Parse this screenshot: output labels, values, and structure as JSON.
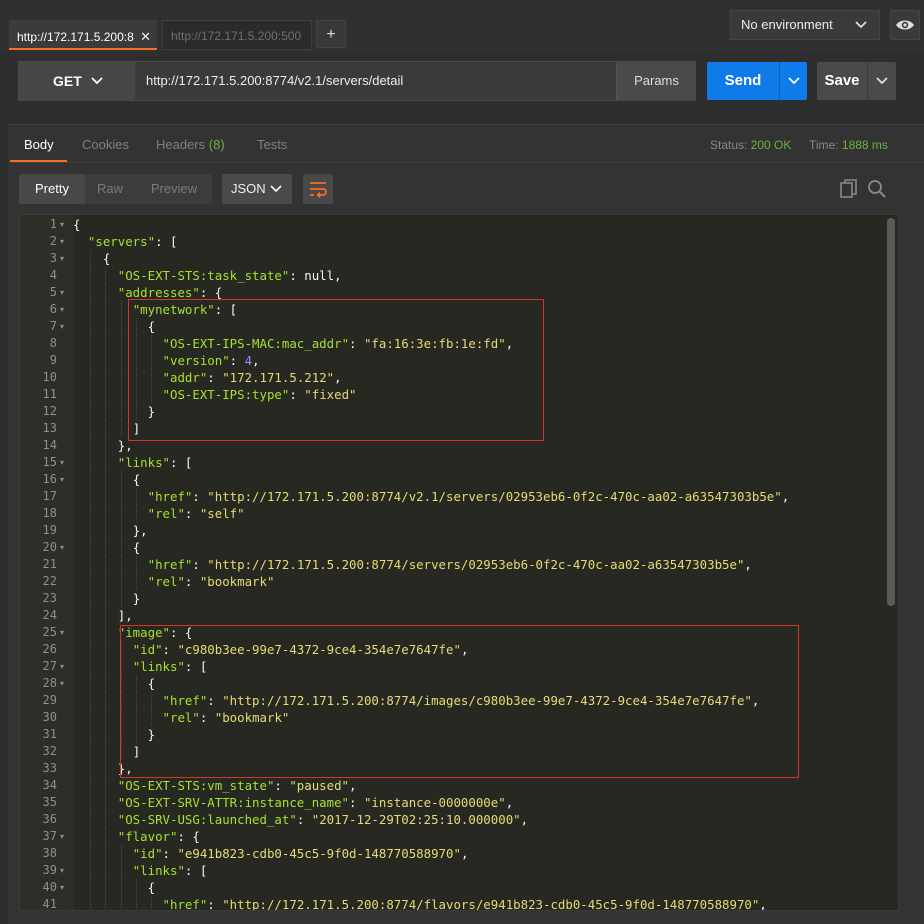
{
  "request_tabs": [
    {
      "label": "http://172.171.5.200:8",
      "active": true,
      "close": "✕"
    },
    {
      "label": "http://172.171.5.200:500",
      "active": false
    }
  ],
  "new_tab_label": "+",
  "environment": {
    "selected": "No environment"
  },
  "request": {
    "method": "GET",
    "url": "http://172.171.5.200:8774/v2.1/servers/detail",
    "params_label": "Params",
    "send_label": "Send",
    "save_label": "Save"
  },
  "response": {
    "tabs": [
      {
        "label": "Body",
        "active": true
      },
      {
        "label": "Cookies"
      },
      {
        "label": "Headers",
        "count": "(8)"
      },
      {
        "label": "Tests"
      }
    ],
    "status_label": "Status:",
    "status_value": "200 OK",
    "time_label": "Time:",
    "time_value": "1888 ms",
    "view_modes": [
      "Pretty",
      "Raw",
      "Preview"
    ],
    "active_view": "Pretty",
    "format": "JSON"
  },
  "colors": {
    "accent": "#f47023",
    "send": "#0f7be8",
    "status_ok": "#6cb43f",
    "highlight_box": "#d8332b"
  },
  "code_lines": [
    {
      "n": 1,
      "fold": true,
      "indent": 0,
      "t": [
        [
          "p",
          "{"
        ]
      ]
    },
    {
      "n": 2,
      "fold": true,
      "indent": 1,
      "t": [
        [
          "k",
          "\"servers\""
        ],
        [
          "p",
          ": ["
        ]
      ]
    },
    {
      "n": 3,
      "fold": true,
      "indent": 2,
      "t": [
        [
          "p",
          "{"
        ]
      ]
    },
    {
      "n": 4,
      "indent": 3,
      "t": [
        [
          "k",
          "\"OS-EXT-STS:task_state\""
        ],
        [
          "p",
          ": null,"
        ]
      ]
    },
    {
      "n": 5,
      "fold": true,
      "indent": 3,
      "t": [
        [
          "k",
          "\"addresses\""
        ],
        [
          "p",
          ": {"
        ]
      ]
    },
    {
      "n": 6,
      "fold": true,
      "indent": 4,
      "t": [
        [
          "k",
          "\"mynetwork\""
        ],
        [
          "p",
          ": ["
        ]
      ]
    },
    {
      "n": 7,
      "fold": true,
      "indent": 5,
      "t": [
        [
          "p",
          "{"
        ]
      ]
    },
    {
      "n": 8,
      "indent": 6,
      "t": [
        [
          "k",
          "\"OS-EXT-IPS-MAC:mac_addr\""
        ],
        [
          "p",
          ": "
        ],
        [
          "s",
          "\"fa:16:3e:fb:1e:fd\""
        ],
        [
          "p",
          ","
        ]
      ]
    },
    {
      "n": 9,
      "indent": 6,
      "t": [
        [
          "k",
          "\"version\""
        ],
        [
          "p",
          ": "
        ],
        [
          "n",
          "4"
        ],
        [
          "p",
          ","
        ]
      ]
    },
    {
      "n": 10,
      "indent": 6,
      "t": [
        [
          "k",
          "\"addr\""
        ],
        [
          "p",
          ": "
        ],
        [
          "s",
          "\"172.171.5.212\""
        ],
        [
          "p",
          ","
        ]
      ]
    },
    {
      "n": 11,
      "indent": 6,
      "t": [
        [
          "k",
          "\"OS-EXT-IPS:type\""
        ],
        [
          "p",
          ": "
        ],
        [
          "s",
          "\"fixed\""
        ]
      ]
    },
    {
      "n": 12,
      "indent": 5,
      "t": [
        [
          "p",
          "}"
        ]
      ]
    },
    {
      "n": 13,
      "indent": 4,
      "t": [
        [
          "p",
          "]"
        ]
      ]
    },
    {
      "n": 14,
      "indent": 3,
      "t": [
        [
          "p",
          "},"
        ]
      ]
    },
    {
      "n": 15,
      "fold": true,
      "indent": 3,
      "t": [
        [
          "k",
          "\"links\""
        ],
        [
          "p",
          ": ["
        ]
      ]
    },
    {
      "n": 16,
      "fold": true,
      "indent": 4,
      "t": [
        [
          "p",
          "{"
        ]
      ]
    },
    {
      "n": 17,
      "indent": 5,
      "t": [
        [
          "k",
          "\"href\""
        ],
        [
          "p",
          ": "
        ],
        [
          "s",
          "\"http://172.171.5.200:8774/v2.1/servers/02953eb6-0f2c-470c-aa02-a63547303b5e\""
        ],
        [
          "p",
          ","
        ]
      ]
    },
    {
      "n": 18,
      "indent": 5,
      "t": [
        [
          "k",
          "\"rel\""
        ],
        [
          "p",
          ": "
        ],
        [
          "s",
          "\"self\""
        ]
      ]
    },
    {
      "n": 19,
      "indent": 4,
      "t": [
        [
          "p",
          "},"
        ]
      ]
    },
    {
      "n": 20,
      "fold": true,
      "indent": 4,
      "t": [
        [
          "p",
          "{"
        ]
      ]
    },
    {
      "n": 21,
      "indent": 5,
      "t": [
        [
          "k",
          "\"href\""
        ],
        [
          "p",
          ": "
        ],
        [
          "s",
          "\"http://172.171.5.200:8774/servers/02953eb6-0f2c-470c-aa02-a63547303b5e\""
        ],
        [
          "p",
          ","
        ]
      ]
    },
    {
      "n": 22,
      "indent": 5,
      "t": [
        [
          "k",
          "\"rel\""
        ],
        [
          "p",
          ": "
        ],
        [
          "s",
          "\"bookmark\""
        ]
      ]
    },
    {
      "n": 23,
      "indent": 4,
      "t": [
        [
          "p",
          "}"
        ]
      ]
    },
    {
      "n": 24,
      "indent": 3,
      "t": [
        [
          "p",
          "],"
        ]
      ]
    },
    {
      "n": 25,
      "fold": true,
      "indent": 3,
      "t": [
        [
          "k",
          "\"image\""
        ],
        [
          "p",
          ": {"
        ]
      ]
    },
    {
      "n": 26,
      "indent": 4,
      "t": [
        [
          "k",
          "\"id\""
        ],
        [
          "p",
          ": "
        ],
        [
          "s",
          "\"c980b3ee-99e7-4372-9ce4-354e7e7647fe\""
        ],
        [
          "p",
          ","
        ]
      ]
    },
    {
      "n": 27,
      "fold": true,
      "indent": 4,
      "t": [
        [
          "k",
          "\"links\""
        ],
        [
          "p",
          ": ["
        ]
      ]
    },
    {
      "n": 28,
      "fold": true,
      "indent": 5,
      "t": [
        [
          "p",
          "{"
        ]
      ]
    },
    {
      "n": 29,
      "indent": 6,
      "t": [
        [
          "k",
          "\"href\""
        ],
        [
          "p",
          ": "
        ],
        [
          "s",
          "\"http://172.171.5.200:8774/images/c980b3ee-99e7-4372-9ce4-354e7e7647fe\""
        ],
        [
          "p",
          ","
        ]
      ]
    },
    {
      "n": 30,
      "indent": 6,
      "t": [
        [
          "k",
          "\"rel\""
        ],
        [
          "p",
          ": "
        ],
        [
          "s",
          "\"bookmark\""
        ]
      ]
    },
    {
      "n": 31,
      "indent": 5,
      "t": [
        [
          "p",
          "}"
        ]
      ]
    },
    {
      "n": 32,
      "indent": 4,
      "t": [
        [
          "p",
          "]"
        ]
      ]
    },
    {
      "n": 33,
      "indent": 3,
      "t": [
        [
          "p",
          "},"
        ]
      ]
    },
    {
      "n": 34,
      "indent": 3,
      "t": [
        [
          "k",
          "\"OS-EXT-STS:vm_state\""
        ],
        [
          "p",
          ": "
        ],
        [
          "s",
          "\"paused\""
        ],
        [
          "p",
          ","
        ]
      ]
    },
    {
      "n": 35,
      "indent": 3,
      "t": [
        [
          "k",
          "\"OS-EXT-SRV-ATTR:instance_name\""
        ],
        [
          "p",
          ": "
        ],
        [
          "s",
          "\"instance-0000000e\""
        ],
        [
          "p",
          ","
        ]
      ]
    },
    {
      "n": 36,
      "indent": 3,
      "t": [
        [
          "k",
          "\"OS-SRV-USG:launched_at\""
        ],
        [
          "p",
          ": "
        ],
        [
          "s",
          "\"2017-12-29T02:25:10.000000\""
        ],
        [
          "p",
          ","
        ]
      ]
    },
    {
      "n": 37,
      "fold": true,
      "indent": 3,
      "t": [
        [
          "k",
          "\"flavor\""
        ],
        [
          "p",
          ": {"
        ]
      ]
    },
    {
      "n": 38,
      "indent": 4,
      "t": [
        [
          "k",
          "\"id\""
        ],
        [
          "p",
          ": "
        ],
        [
          "s",
          "\"e941b823-cdb0-45c5-9f0d-148770588970\""
        ],
        [
          "p",
          ","
        ]
      ]
    },
    {
      "n": 39,
      "fold": true,
      "indent": 4,
      "t": [
        [
          "k",
          "\"links\""
        ],
        [
          "p",
          ": ["
        ]
      ]
    },
    {
      "n": 40,
      "fold": true,
      "indent": 5,
      "t": [
        [
          "p",
          "{"
        ]
      ]
    },
    {
      "n": 41,
      "indent": 6,
      "t": [
        [
          "k",
          "\"href\""
        ],
        [
          "p",
          ": "
        ],
        [
          "s",
          "\"http://172.171.5.200:8774/flavors/e941b823-cdb0-45c5-9f0d-148770588970\""
        ],
        [
          "p",
          ","
        ]
      ]
    }
  ]
}
